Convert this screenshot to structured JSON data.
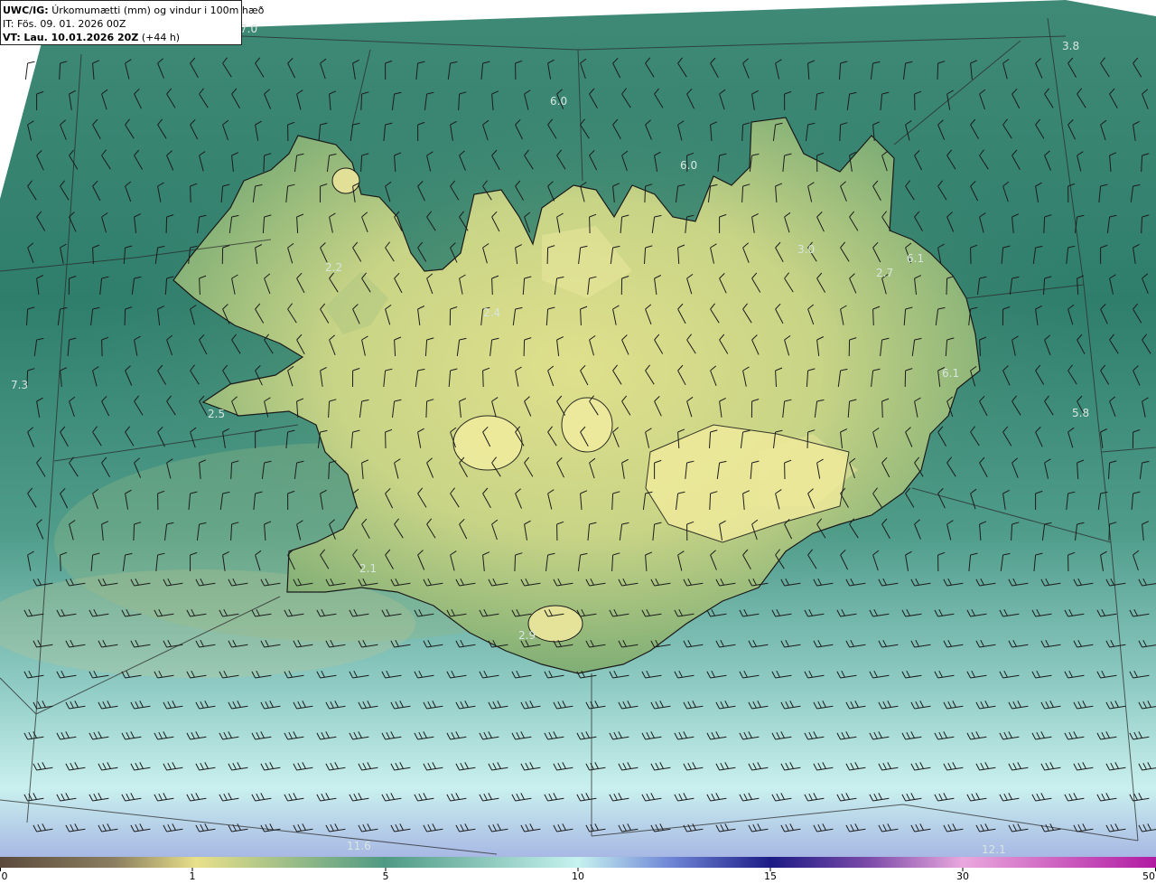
{
  "header": {
    "model": "UWC/IG:",
    "description": "Úrkomumætti (mm) og vindur i 100m hæð",
    "initial_time": "IT: Fös. 09. 01. 2026 00Z",
    "valid_prefix": "VT:",
    "valid_time": "Lau. 10.01.2026 20Z",
    "lead": "(+44 h)"
  },
  "map_values": [
    "7.0",
    "3.8",
    "6.0",
    "6.0",
    "3.0",
    "6.1",
    "2.7",
    "2.2",
    "2.4",
    "7.3",
    "2.5",
    "6.1",
    "5.8",
    "2.1",
    "2.9",
    "11.6",
    "12.1"
  ],
  "colorbar": {
    "ticks": [
      "0",
      "1",
      "5",
      "10",
      "15",
      "30",
      "50"
    ],
    "colors": [
      "#5b4a3c",
      "#a0946a",
      "#e8e08a",
      "#4f9a84",
      "#c6f2ef",
      "#6f86d6",
      "#1c1b85",
      "#8a4aa8",
      "#e9a8dd",
      "#b01aa2"
    ]
  },
  "colors": {
    "sea": "#3c8a78",
    "land_low": "#9dbb78",
    "land_high": "#e2e28e",
    "coast_line": "#1a1a1a"
  }
}
